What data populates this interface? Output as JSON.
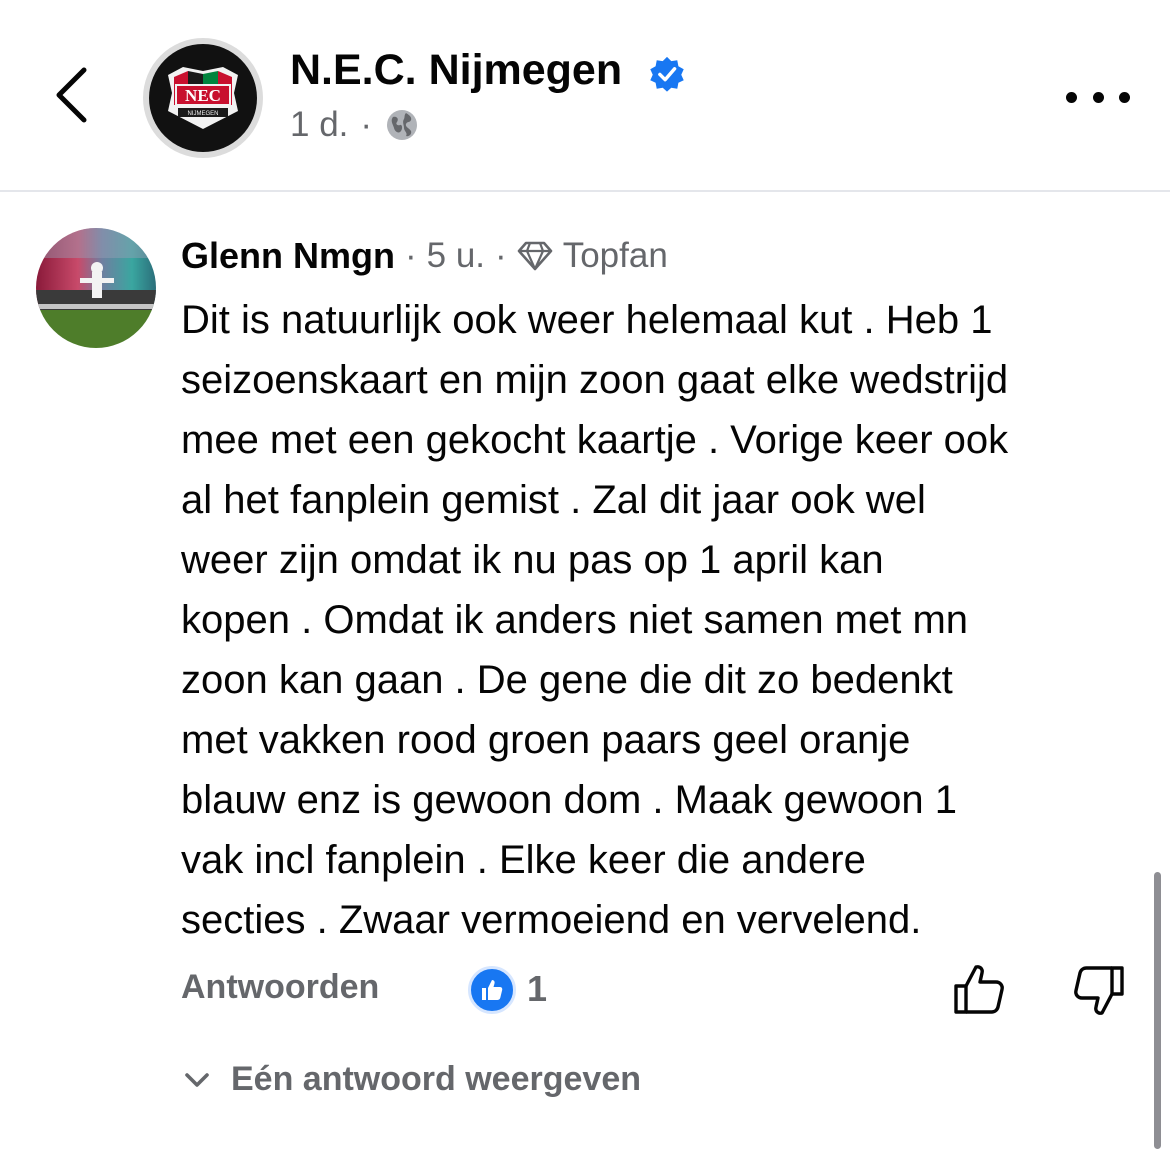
{
  "header": {
    "page_name": "N.E.C. Nijmegen",
    "post_time": "1 d.",
    "dot": "·",
    "logo_text": "NEC",
    "logo_subtext": "NIJMEGEN"
  },
  "comment": {
    "author": "Glenn Nmgn",
    "dot1": "·",
    "time": "5 u.",
    "dot2": "·",
    "badge": "Topfan",
    "lines": [
      "Dit is natuurlijk ook weer helemaal kut . Heb 1",
      "seizoenskaart en mijn zoon gaat elke wedstrijd",
      "mee met een gekocht kaartje . Vorige keer ook",
      "al het fanplein gemist . Zal dit jaar ook wel",
      "weer zijn omdat ik nu pas op 1 april kan",
      "kopen . Omdat ik anders niet samen met mn",
      "zoon kan gaan . De gene die dit zo bedenkt",
      "met vakken rood groen paars geel oranje",
      "blauw enz is gewoon dom . Maak gewoon 1",
      "vak incl fanplein . Elke keer die andere",
      "secties . Zwaar vermoeiend en vervelend."
    ],
    "reply_label": "Antwoorden",
    "like_count": "1",
    "view_replies": "Eén antwoord weergeven"
  },
  "colors": {
    "accent": "#1877f2",
    "secondary_text": "#65676b"
  },
  "icons": [
    "back-icon",
    "verified-icon",
    "globe-icon",
    "more-icon",
    "diamond-icon",
    "like-reaction-icon",
    "thumbs-up-icon",
    "thumbs-down-icon",
    "chevron-down-icon"
  ]
}
